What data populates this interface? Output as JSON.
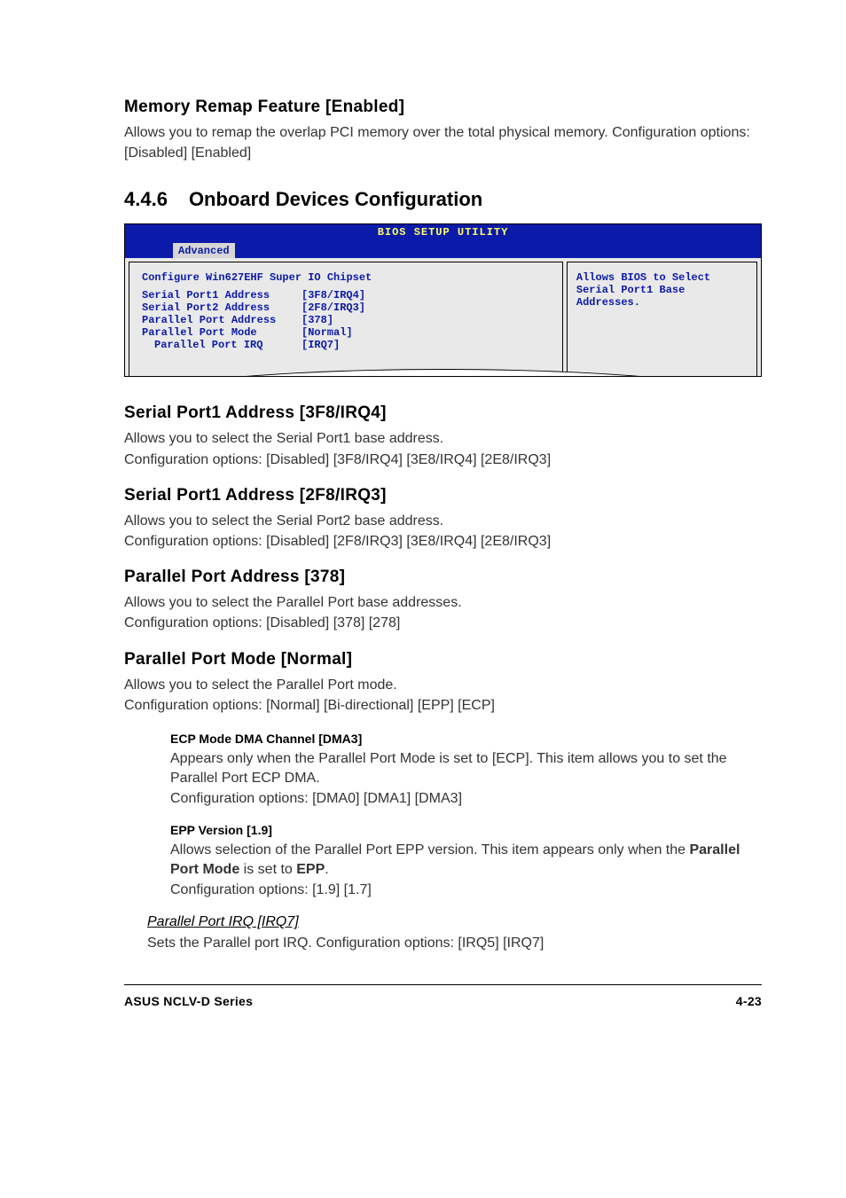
{
  "memory_remap": {
    "heading": "Memory Remap Feature [Enabled]",
    "body": "Allows you to remap the overlap PCI memory over the total physical memory. Configuration options: [Disabled] [Enabled]"
  },
  "main_section": {
    "number": "4.4.6",
    "title": "Onboard Devices Configuration"
  },
  "bios": {
    "title": "BIOS SETUP UTILITY",
    "tab": "Advanced",
    "config_title": "Configure Win627EHF Super IO Chipset",
    "rows": [
      {
        "label": "Serial Port1 Address",
        "value": "[3F8/IRQ4]",
        "indent": false
      },
      {
        "label": "Serial Port2 Address",
        "value": "[2F8/IRQ3]",
        "indent": false
      },
      {
        "label": "Parallel Port Address",
        "value": "[378]",
        "indent": false
      },
      {
        "label": "Parallel Port Mode",
        "value": "[Normal]",
        "indent": false
      },
      {
        "label": "Parallel Port IRQ",
        "value": "[IRQ7]",
        "indent": true
      }
    ],
    "help": "Allows BIOS to Select Serial Port1 Base Addresses."
  },
  "sections": [
    {
      "heading": "Serial Port1 Address [3F8/IRQ4]",
      "body": "Allows you to select the Serial Port1 base address.\nConfiguration options: [Disabled] [3F8/IRQ4] [3E8/IRQ4] [2E8/IRQ3]"
    },
    {
      "heading": "Serial Port1 Address [2F8/IRQ3]",
      "body": "Allows you to select the Serial Port2 base address.\nConfiguration options: [Disabled] [2F8/IRQ3] [3E8/IRQ4] [2E8/IRQ3]"
    },
    {
      "heading": "Parallel Port Address [378]",
      "body": "Allows you to select the Parallel Port base addresses.\nConfiguration options: [Disabled] [378] [278]"
    },
    {
      "heading": "Parallel Port Mode [Normal]",
      "body": "Allows you to select the Parallel Port  mode.\nConfiguration options: [Normal] [Bi-directional] [EPP] [ECP]"
    }
  ],
  "sub1": {
    "heading": "ECP Mode DMA Channel [DMA3]",
    "body": "Appears only when the Parallel Port Mode is set to [ECP]. This item allows you to set the Parallel Port ECP DMA.\nConfiguration options: [DMA0] [DMA1] [DMA3]"
  },
  "sub2": {
    "heading": "EPP Version [1.9]",
    "body_pre": "Allows selection of the Parallel Port EPP version. This item appears only when the ",
    "bold1": "Parallel Port Mode",
    "body_mid": " is set to ",
    "bold2": "EPP",
    "body_post": ".\nConfiguration options: [1.9] [1.7]"
  },
  "sub3": {
    "heading": "Parallel Port IRQ [IRQ7]",
    "body": "Sets the Parallel port IRQ. Configuration options: [IRQ5] [IRQ7]"
  },
  "footer": {
    "left": "ASUS NCLV-D Series",
    "right": "4-23"
  }
}
